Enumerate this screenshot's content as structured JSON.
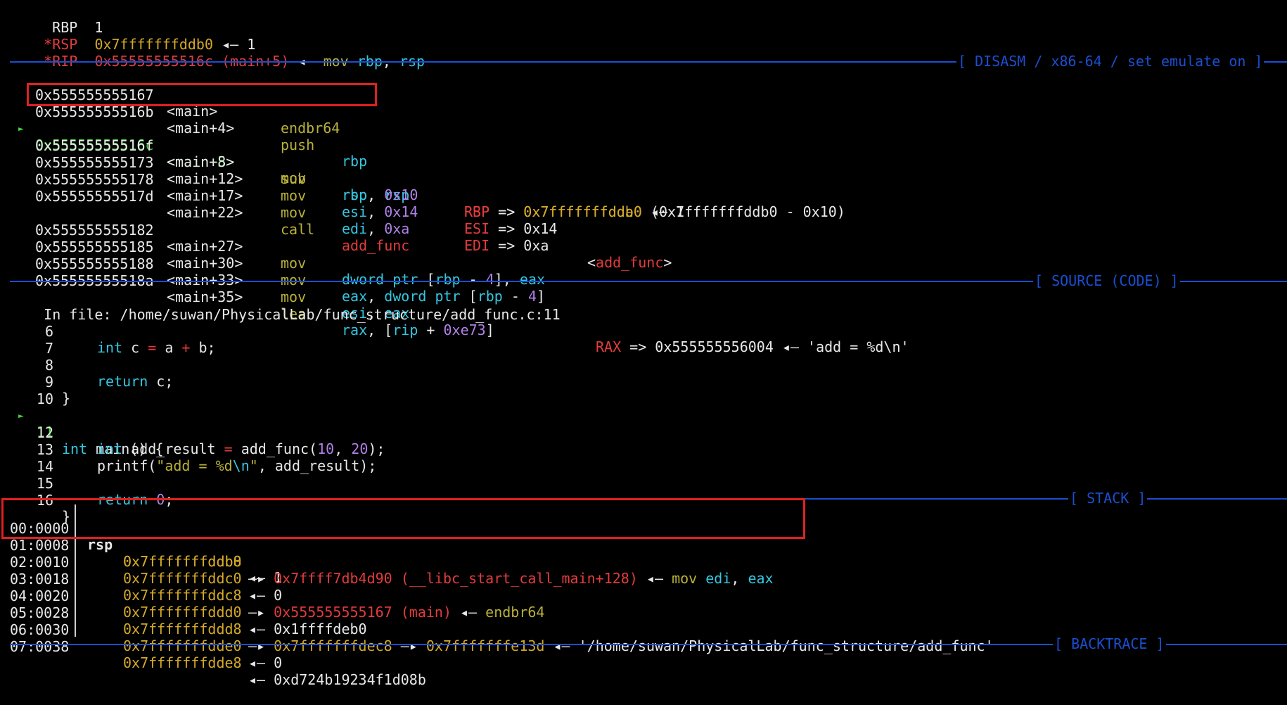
{
  "registers": {
    "partial_top": "",
    "rbp": {
      "name": "RBP",
      "value": "1"
    },
    "rsp": {
      "flag": "*",
      "name": "RSP",
      "value": "0x7fffffffddb0",
      "arrow": "◂—",
      "target": "1"
    },
    "rip": {
      "flag": "*",
      "name": "RIP",
      "value": "0x55555555516c",
      "sym": "(main+5)",
      "arrow": "◂—",
      "ins": "mov",
      "op1": "rbp",
      "comma": ",",
      "op2": "rsp"
    }
  },
  "disasm": {
    "title": "[ DISASM / x86-64 / set emulate on ]",
    "lines": [
      {
        "addr": "0x555555555167",
        "sym": "<main>",
        "mn": "endbr64",
        "ops": "",
        "note": ""
      },
      {
        "addr": "0x55555555516b",
        "sym": "<main+4>",
        "mn": "push",
        "ops": "rbp",
        "note": ""
      },
      {
        "addr": "0x55555555516c",
        "sym": "<main+5>",
        "mn": "mov",
        "ops": "rbp, rsp",
        "note": "RBP => 0x7fffffffddb0 ◂— 1",
        "current": true
      },
      {
        "addr": "0x55555555516f",
        "sym": "<main+8>",
        "mn": "sub",
        "ops": "rsp, 0x10",
        "note": "RSP => 0x7fffffffdda0 (0x7fffffffddb0 - 0x10)"
      },
      {
        "addr": "0x555555555173",
        "sym": "<main+12>",
        "mn": "mov",
        "ops": "esi, 0x14",
        "note": "ESI => 0x14"
      },
      {
        "addr": "0x555555555178",
        "sym": "<main+17>",
        "mn": "mov",
        "ops": "edi, 0xa",
        "note": "EDI => 0xa"
      },
      {
        "addr": "0x55555555517d",
        "sym": "<main+22>",
        "mn": "call",
        "ops": "add_func",
        "note": "<add_func>"
      },
      {
        "addr": "0x555555555182",
        "sym": "<main+27>",
        "mn": "mov",
        "ops": "dword ptr [rbp - 4], eax",
        "note": ""
      },
      {
        "addr": "0x555555555185",
        "sym": "<main+30>",
        "mn": "mov",
        "ops": "eax, dword ptr [rbp - 4]",
        "note": ""
      },
      {
        "addr": "0x555555555188",
        "sym": "<main+33>",
        "mn": "mov",
        "ops": "esi, eax",
        "note": ""
      },
      {
        "addr": "0x55555555518a",
        "sym": "<main+35>",
        "mn": "lea",
        "ops": "rax, [rip + 0xe73]",
        "note": "RAX => 0x555555556004 ◂— 'add = %d\\n'"
      }
    ]
  },
  "source": {
    "title": "[ SOURCE (CODE) ]",
    "in_file_label": "In file:",
    "path": "/home/suwan/PhysicalLab/func_structure/add_func.c:11",
    "lines": [
      {
        "num": "6",
        "code": "int c = a + b;"
      },
      {
        "num": "7",
        "code": ""
      },
      {
        "num": "8",
        "code": "return c;"
      },
      {
        "num": "9",
        "code": "}"
      },
      {
        "num": "10",
        "code": ""
      },
      {
        "num": "11",
        "code": "int main() {",
        "current": true
      },
      {
        "num": "12",
        "code": "int add_result = add_func(10, 20);"
      },
      {
        "num": "13",
        "code": "printf(\"add = %d\\n\", add_result);"
      },
      {
        "num": "14",
        "code": ""
      },
      {
        "num": "15",
        "code": "return 0;"
      },
      {
        "num": "16",
        "code": "}"
      }
    ]
  },
  "stack": {
    "title": "[ STACK ]",
    "rows": [
      {
        "idx": "00:0000",
        "reg": "rsp",
        "addr": "0x7fffffffddb0",
        "rest": "◂— 1"
      },
      {
        "idx": "01:0008",
        "reg": "",
        "addr": "0x7fffffffddb8",
        "rest": "—▸ 0x7ffff7db4d90 (__libc_start_call_main+128) ◂— mov edi, eax"
      },
      {
        "idx": "02:0010",
        "reg": "",
        "addr": "0x7fffffffddc0",
        "rest": "◂— 0"
      },
      {
        "idx": "03:0018",
        "reg": "",
        "addr": "0x7fffffffddc8",
        "rest": "—▸ 0x555555555167 (main) ◂— endbr64"
      },
      {
        "idx": "04:0020",
        "reg": "",
        "addr": "0x7fffffffddd0",
        "rest": "◂— 0x1ffffdeb0"
      },
      {
        "idx": "05:0028",
        "reg": "",
        "addr": "0x7fffffffddd8",
        "rest": "—▸ 0x7fffffffdec8 —▸ 0x7fffffffe13d ◂— '/home/suwan/PhysicalLab/func_structure/add_func'"
      },
      {
        "idx": "06:0030",
        "reg": "",
        "addr": "0x7fffffffdde0",
        "rest": "◂— 0"
      },
      {
        "idx": "07:0038",
        "reg": "",
        "addr": "0x7fffffffdde8",
        "rest": "◂— 0xd724b19234f1d08b"
      }
    ]
  },
  "backtrace": {
    "title": "[ BACKTRACE ]"
  },
  "colors": {
    "background": "#000000",
    "separator": "#1b4fd1",
    "highlight_box": "#e02020",
    "current_line": "#3fd13b",
    "address_yellow": "#d4a928",
    "register_cyan": "#35c6e0",
    "mnemonic_olive": "#b8b13a",
    "error_red": "#e33c3c"
  }
}
